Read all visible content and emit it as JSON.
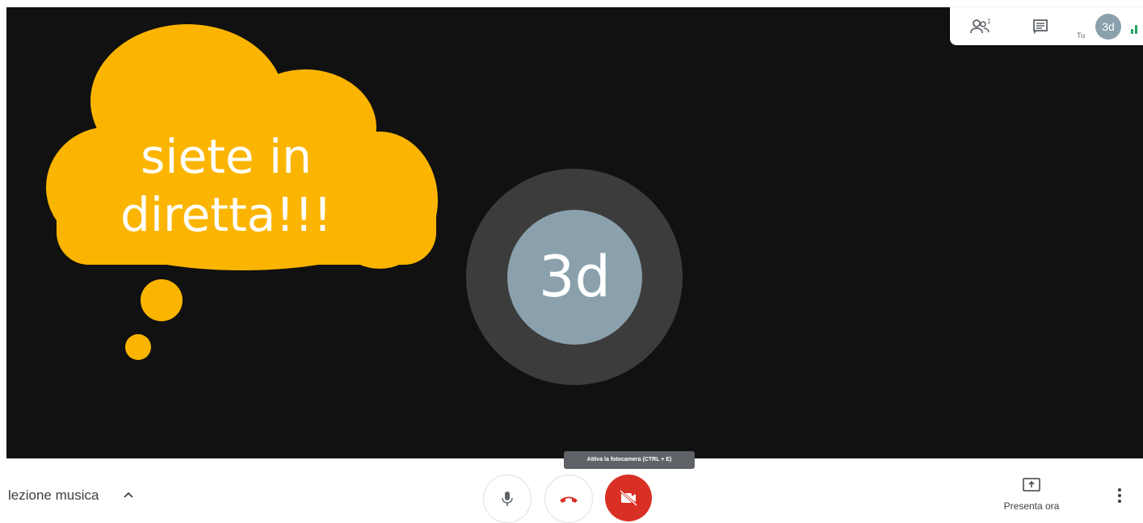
{
  "stage": {
    "cloud_text_line1": "siete in",
    "cloud_text_line2": "diretta!!!",
    "avatar_initials": "3d",
    "cloud_color": "#fbb500"
  },
  "topbar": {
    "people_icon": "people-icon",
    "people_count": "1",
    "chat_icon": "chat-icon",
    "you_label": "Tu",
    "avatar_initials": "3d"
  },
  "bottombar": {
    "meeting_name": "lezione musica",
    "mic_icon": "mic-icon",
    "hangup_icon": "hangup-icon",
    "camera_icon": "camera-off-icon",
    "camera_tooltip": "Attiva la fotocamera (CTRL + E)",
    "present_label": "Presenta ora",
    "more_icon": "more-vert-icon"
  },
  "colors": {
    "danger": "#d93025",
    "avatar": "#8aa1ad",
    "stage_bg": "#111111"
  }
}
